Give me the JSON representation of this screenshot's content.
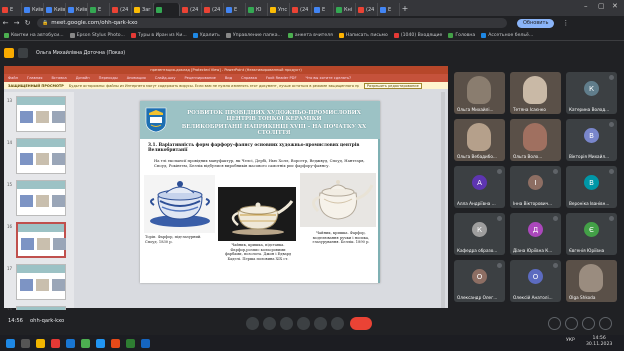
{
  "browser": {
    "tabs": [
      {
        "label": "Е",
        "color": "#ea4335"
      },
      {
        "label": "Київ",
        "color": "#4285f4"
      },
      {
        "label": "Київ",
        "color": "#4285f4"
      },
      {
        "label": "Київ",
        "color": "#4285f4"
      },
      {
        "label": "Е",
        "color": "#34a853"
      },
      {
        "label": "(24",
        "color": "#ea4335"
      },
      {
        "label": "Заг",
        "color": "#fbbc05"
      },
      {
        "label": "",
        "color": "#34a853"
      },
      {
        "label": "(24",
        "color": "#ea4335"
      },
      {
        "label": "(24",
        "color": "#ea4335"
      },
      {
        "label": "Е",
        "color": "#4285f4"
      },
      {
        "label": "Ю",
        "color": "#34a853"
      },
      {
        "label": "Упс",
        "color": "#fbbc05"
      },
      {
        "label": "(24",
        "color": "#ea4335"
      },
      {
        "label": "Е",
        "color": "#4285f4"
      },
      {
        "label": "Кнi",
        "color": "#34a853"
      },
      {
        "label": "(24",
        "color": "#ea4335"
      },
      {
        "label": "Е",
        "color": "#4285f4"
      }
    ],
    "new_tab": "+",
    "url": "meet.google.com/ohh-qark-kxo",
    "refresh_label": "Обновить",
    "bookmarks": [
      {
        "label": "Квитки на автобуси...",
        "color": "#4caf50"
      },
      {
        "label": "Epson Stylus Photo...",
        "color": "#888888"
      },
      {
        "label": "Туры в Иран из Ки...",
        "color": "#e53935"
      },
      {
        "label": "Удалить",
        "color": "#1e88e5"
      },
      {
        "label": "Управление папка...",
        "color": "#888888"
      },
      {
        "label": "анкета вчителя",
        "color": "#4caf50"
      },
      {
        "label": "Написать письмо",
        "color": "#ffb300"
      },
      {
        "label": "(1040) Входящие",
        "color": "#e53935"
      },
      {
        "label": "Головна",
        "color": "#43a047"
      },
      {
        "label": "Ассетьное бельё...",
        "color": "#1e88e5"
      }
    ]
  },
  "meet": {
    "presenter_label": "Ольга Михайлівна Доточна (Показ)",
    "meeting_code": "ohh-qark-kxo",
    "time": "14:56",
    "participants": [
      {
        "name": "Ольга Михайлі...",
        "photo": true,
        "bg": "#8a7d6f"
      },
      {
        "name": "Тетяна Ісаєнко",
        "photo": true,
        "bg": "#c9b9a6"
      },
      {
        "name": "Катерина Волод...",
        "initial": "К",
        "color": "#607d8b"
      },
      {
        "name": "Ольга Вебадибо...",
        "photo": true,
        "bg": "#b5a08b"
      },
      {
        "name": "Ольга Воло...",
        "photo": true,
        "bg": "#a07060"
      },
      {
        "name": "Вікторія Михайл...",
        "initial": "В",
        "color": "#7986cb"
      },
      {
        "name": "Алла Андріївна ...",
        "initial": "А",
        "color": "#5e35b1"
      },
      {
        "name": "Інна Вікторович...",
        "initial": "І",
        "color": "#8d6e63"
      },
      {
        "name": "Вероніка Іванівн...",
        "initial": "В",
        "color": "#0097a7"
      },
      {
        "name": "Кафедра образо...",
        "initial": "К",
        "color": "#9e9e9e"
      },
      {
        "name": "Діана Юріївна К...",
        "initial": "Д",
        "color": "#ab47bc"
      },
      {
        "name": "Євгенія Юріївна",
        "initial": "Є",
        "color": "#43a047"
      },
      {
        "name": "Олександр Олег...",
        "initial": "О",
        "color": "#8d6e63"
      },
      {
        "name": "Олексій Анатолі...",
        "initial": "О",
        "color": "#5c6bc0"
      },
      {
        "name": "Olga Shkoda",
        "photo": true,
        "bg": "#9a8c7f"
      }
    ]
  },
  "ppt": {
    "title_bar": "презентация-доклад [Protected View] - PowerPoint (Неактивированный продукт)",
    "ribbon_tabs": [
      "Файл",
      "Главная",
      "Вставка",
      "Дизайн",
      "Переходы",
      "Анимация",
      "Слайд-шоу",
      "Рецензирование",
      "Вид",
      "Справка",
      "Foxit Reader PDF",
      "Что вы хотите сделать?"
    ],
    "warning_label": "ЗАЩИЩЕННЫЙ ПРОСМОТР",
    "warning_text": "Будьте осторожны: файлы из Интернета могут содержать вирусы. Если вам не нужно изменять этот документ, лучше остаться в режиме защищенного просмотра.",
    "warning_button": "Разрешить редактирование",
    "thumbnail_numbers": [
      "13",
      "14",
      "15",
      "16",
      "17",
      "18"
    ],
    "slide": {
      "banner_lines": [
        "РОЗВИТОК ПРОВІДНИХ ХУДОЖНЬО-ПРОМИСЛОВИХ ЦЕНТРІВ ТОНКОЇ КЕРАМІКИ",
        "ВЕЛИКОБРИТАНІЇ НАПРИКІНЦІ XVIII – НА ПОЧАТКУ XX СТОЛІТТЯ"
      ],
      "heading": "3.1. Варіативність форм фарфору-фаянсу основних художньо-промислових центрів Великобританії",
      "paragraph": "На тлі експансії провідних мануфактур, як Челсі, Дербі, Нью Холл, Ворсетр, Веджвуд, Споуд, Нантгарв, Споуд, Рокінгем, Беллік відбулися виробників масового самотніх рис фарфору-фаянсу.",
      "captions": [
        "Торіп. Фарфор, підглазурний. Споуд. 1830 р.",
        "Чайник, кришка, підставка. Фарфор,розпис кольоровими фарбами, позолота. Джон і Едвард Баделі. Перша половина XIX ст.",
        "Чайник, кришка. Фарфор, моделювання ручки і носика, глазурування. Беллік. 1890 р."
      ]
    }
  },
  "system": {
    "clock_time": "14:56",
    "clock_date": "30.11.2023",
    "language": "УКР"
  }
}
